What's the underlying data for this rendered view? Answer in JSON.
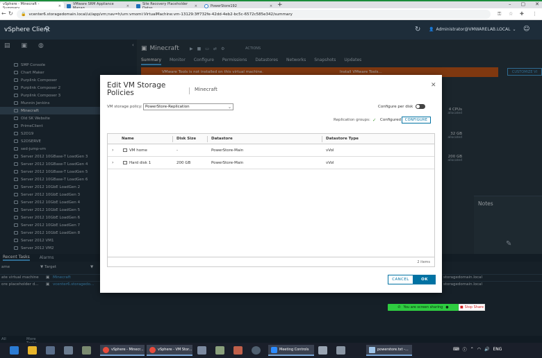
{
  "browser": {
    "tabs": [
      {
        "label": "vSphere - Minecraft - Summary"
      },
      {
        "label": "VMware SRM Appliance Manag"
      },
      {
        "label": "Site Recovery Placeholder Datas"
      },
      {
        "label": "PowerStore192"
      }
    ],
    "new_tab": "+",
    "url": "vcenter6.storagedomain.local/ui/app/vm;nav=h/urn:vmomi:VirtualMachine:vm-13129:3ff732fe-42dd-4eb2-bc5c-6572c585e342/summary"
  },
  "vsphere": {
    "title": "vSphere Client",
    "user": "Administrator@VMWARELAB.LOCAL"
  },
  "inventory": {
    "items": [
      "SMP Console",
      "Chart Maker",
      "Purplink Composer",
      "Purplink Composer 2",
      "Purplink Composer 3",
      "Munnin Jenkins",
      "Minecraft",
      "Old SK Website",
      "PrimeClient",
      "S2D19",
      "S2DSERVE",
      "sed-jump-vm",
      "Server 2012 10GBase-T LoadGen 3",
      "Server 2012 10GBase-T LoadGen 4",
      "Server 2012 10GBase-T LoadGen 5",
      "Server 2012 10GBase-T LoadGen 6",
      "Server 2012 10GbE LoadGen 2",
      "Server 2012 10GbE LoadGen 3",
      "Server 2012 10GbE LoadGen 4",
      "Server 2012 10GbE LoadGen 5",
      "Server 2012 10GbE LoadGen 6",
      "Server 2012 10GbE LoadGen 7",
      "Server 2012 10GbE LoadGen 8",
      "Server 2012 VM1",
      "Server 2012 VM2"
    ]
  },
  "main": {
    "vm_name": "Minecraft",
    "actions_label": "ACTIONS",
    "tabs": [
      "Summary",
      "Monitor",
      "Configure",
      "Permissions",
      "Datastores",
      "Networks",
      "Snapshots",
      "Updates"
    ],
    "warning": "VMware Tools is not installed on this virtual machine.",
    "warning_action": "Install VMware Tools...",
    "customize_label": "CUSTOMIZE VI",
    "stats": [
      {
        "value": "4 CPUs",
        "sub": "allocated"
      },
      {
        "value": "32 GB",
        "sub": "allocated"
      },
      {
        "value": "200 GB",
        "sub": "allocated"
      }
    ],
    "notes_title": "Notes"
  },
  "tasks": {
    "tabs": [
      "Recent Tasks",
      "Alarms"
    ],
    "columns": [
      "ame",
      "Target"
    ],
    "rows": [
      {
        "name": "ate virtual machine",
        "target": "Minecraft",
        "server": "storagedomain.local"
      },
      {
        "name": "ore placeholder d...",
        "target": "vcenter6.storagedo...",
        "server": "storagedomain.local"
      }
    ],
    "footer_all": "All",
    "footer_more": "More Tasks"
  },
  "share": {
    "status": "You are screen sharing",
    "stop": "Stop Share"
  },
  "taskbar": {
    "apps": [
      "vSphere - Minecr...",
      "vSphere - VM Stor...",
      "Meeting Controls",
      "powerstore.txt -..."
    ],
    "lang": "ENG"
  },
  "modal": {
    "title": "Edit VM Storage Policies",
    "vm": "Minecraft",
    "policy_label": "VM storage policy:",
    "policy_value": "PowerStore-Replication",
    "per_disk_label": "Configure per disk",
    "replication_label": "Replication groups:",
    "replication_status": "Configured",
    "configure_label": "CONFIGURE",
    "columns": [
      "Name",
      "Disk Size",
      "Datastore",
      "Datastore Type"
    ],
    "rows": [
      {
        "name": "VM home",
        "size": "-",
        "datastore": "PowerStore-Main",
        "type": "vVol"
      },
      {
        "name": "Hard disk 1",
        "size": "200 GB",
        "datastore": "PowerStore-Main",
        "type": "vVol"
      }
    ],
    "items_count": "2 items",
    "cancel_label": "CANCEL",
    "ok_label": "OK"
  }
}
